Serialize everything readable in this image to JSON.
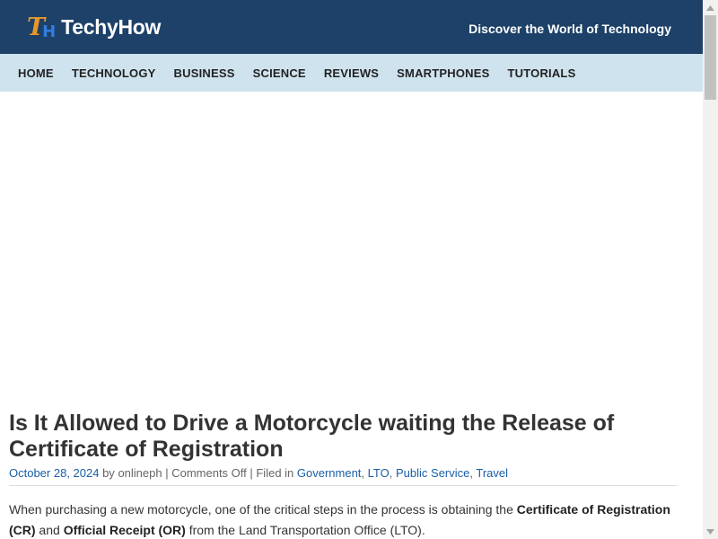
{
  "header": {
    "logo_mark": "T",
    "logo_mark_h": "H",
    "logo_text": "TechyHow",
    "tagline": "Discover the World of Technology"
  },
  "nav": {
    "items": [
      "HOME",
      "TECHNOLOGY",
      "BUSINESS",
      "SCIENCE",
      "REVIEWS",
      "SMARTPHONES",
      "TUTORIALS"
    ]
  },
  "article": {
    "title": "Is It Allowed to Drive a Motorcycle waiting the Release of Certificate of Registration",
    "meta": {
      "date": "October 28, 2024",
      "by": " by ",
      "author": "onlineph",
      "sep1": " | ",
      "comments": "Comments Off",
      "sep2": " | Filed in ",
      "categories": [
        "Government",
        "LTO",
        "Public Service",
        "Travel"
      ],
      "comma": ", "
    },
    "para1": {
      "part1": "When purchasing a new motorcycle, one of the critical steps in the process is obtaining the ",
      "bold1": "Certificate of Registration (CR)",
      "part2": " and ",
      "bold2": "Official Receipt (OR)",
      "part3": " from the Land Transportation Office (LTO)."
    }
  },
  "colors": {
    "header_bg": "#1d4168",
    "nav_bg": "#cfe3ee",
    "link": "#1a5fa8",
    "logo_orange": "#e8962a",
    "logo_blue": "#2f7de0"
  }
}
